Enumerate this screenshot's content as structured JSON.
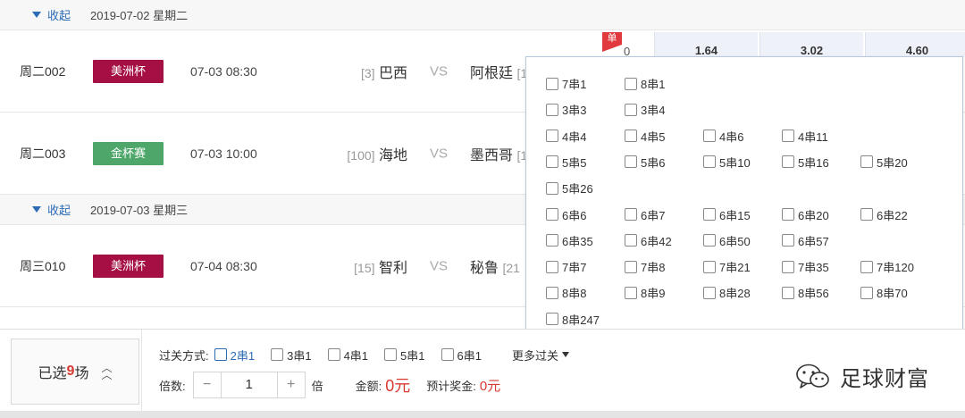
{
  "groups": [
    {
      "collapse_label": "收起",
      "date": "2019-07-02 星期二"
    },
    {
      "collapse_label": "收起",
      "date": "2019-07-03 星期三"
    }
  ],
  "matches": [
    {
      "id": "周二002",
      "league": "美洲杯",
      "league_color": "#a50f43",
      "time": "07-03 08:30",
      "home_rank": "[3]",
      "home": "巴西",
      "vs": "VS",
      "away": "阿根廷",
      "away_rank": "[1"
    },
    {
      "id": "周二003",
      "league": "金杯赛",
      "league_color": "#4ea66a",
      "time": "07-03 10:00",
      "home_rank": "[100]",
      "home": "海地",
      "vs": "VS",
      "away": "墨西哥",
      "away_rank": "[1"
    },
    {
      "id": "周三010",
      "league": "美洲杯",
      "league_color": "#a50f43",
      "time": "07-04 08:30",
      "home_rank": "[15]",
      "home": "智利",
      "vs": "VS",
      "away": "秘鲁",
      "away_rank": "[21"
    }
  ],
  "odds_row": {
    "dan_flag": "单",
    "handicap": "0",
    "odds": [
      "1.64",
      "3.02",
      "4.60"
    ]
  },
  "popup_options": [
    [
      "7串1",
      "8串1"
    ],
    [
      "3串3",
      "3串4"
    ],
    [
      "4串4",
      "4串5",
      "4串6",
      "4串11"
    ],
    [
      "5串5",
      "5串6",
      "5串10",
      "5串16",
      "5串20"
    ],
    [
      "5串26"
    ],
    [
      "6串6",
      "6串7",
      "6串15",
      "6串20",
      "6串22"
    ],
    [
      "6串35",
      "6串42",
      "6串50",
      "6串57"
    ],
    [
      "7串7",
      "7串8",
      "7串21",
      "7串35",
      "7串120"
    ],
    [
      "8串8",
      "8串9",
      "8串28",
      "8串56",
      "8串70"
    ],
    [
      "8串247"
    ]
  ],
  "bottom": {
    "selected_prefix": "已选",
    "selected_count": "9",
    "selected_suffix": "场",
    "pass_label": "过关方式:",
    "pass_options": [
      "2串1",
      "3串1",
      "4串1",
      "5串1",
      "6串1"
    ],
    "more_label": "更多过关",
    "multiplier_label": "倍数:",
    "minus": "−",
    "multiplier_value": "1",
    "plus": "+",
    "multiplier_unit": "倍",
    "amount_label": "金额:",
    "amount_value": "0元",
    "prize_label": "预计奖金:",
    "prize_value": "0元"
  },
  "watermark": "足球财富"
}
